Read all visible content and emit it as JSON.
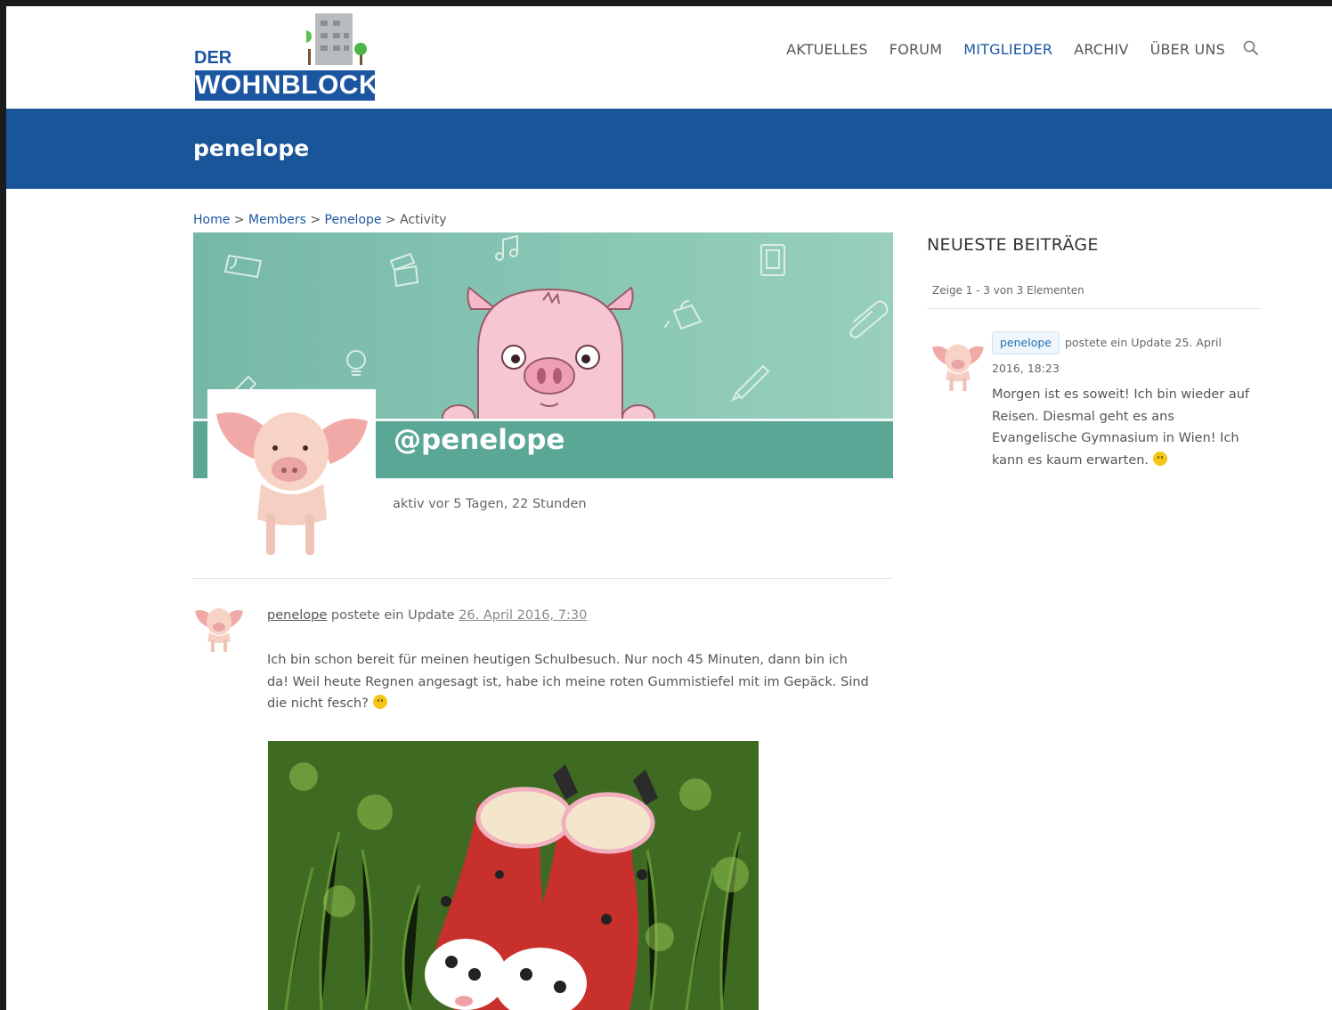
{
  "site": {
    "logo_small": "DER",
    "logo_main": "WOHNBLOCK"
  },
  "nav": {
    "items": [
      {
        "label": "AKTUELLES"
      },
      {
        "label": "FORUM"
      },
      {
        "label": "MITGLIEDER"
      },
      {
        "label": "ARCHIV"
      },
      {
        "label": "ÜBER UNS"
      }
    ],
    "active": "MITGLIEDER",
    "search_icon": "search-icon"
  },
  "page": {
    "title": "penelope"
  },
  "breadcrumb": {
    "items": [
      "Home",
      "Members",
      "Penelope",
      "Activity"
    ],
    "separator": ">"
  },
  "profile": {
    "handle": "@penelope",
    "last_active": "aktiv vor 5 Tagen, 22 Stunden"
  },
  "activity": {
    "user": "penelope",
    "action": "postete ein Update",
    "date": "26. April 2016, 7:30",
    "text": "Ich bin schon bereit für meinen heutigen Schulbesuch.  Nur noch 45 Minuten, dann bin ich da! Weil heute Regnen angesagt ist, habe ich meine roten Gummistiefel mit im Gepäck. Sind die nicht fesch?"
  },
  "sidebar": {
    "title": "NEUESTE BEITRÄGE",
    "count": "Zeige 1 - 3 von 3 Elementen",
    "post": {
      "user": "penelope",
      "meta": "postete ein Update 25. April 2016, 18:23",
      "text": "Morgen ist es soweit! Ich bin wieder auf Reisen. Diesmal geht es ans Evangelische Gymnasium in Wien! Ich kann es kaum erwarten."
    }
  },
  "colors": {
    "brand_blue": "#1a5599",
    "link_blue": "#1d56a0",
    "cover_teal": "#5ba795"
  }
}
